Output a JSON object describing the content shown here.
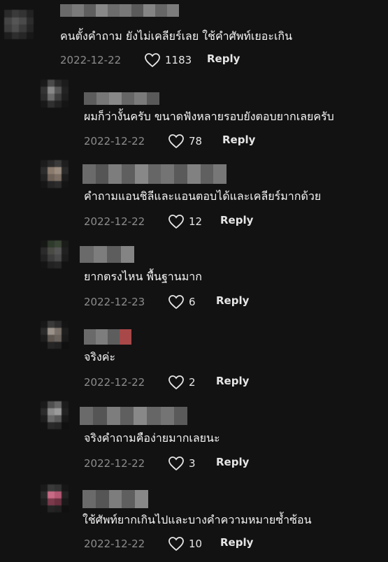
{
  "comments": [
    {
      "text": "คนตั้งคำถาม ยังไม่เคลียร์เลย ใช้คำศัพท์เยอะเกิน",
      "date": "2022-12-22",
      "likes": "1183",
      "reply_label": "Reply"
    },
    {
      "text": "ผมก็ว่างั้นครับ ขนาดฟังหลายรอบยังตอบยากเลยครับ",
      "date": "2022-12-22",
      "likes": "78",
      "reply_label": "Reply"
    },
    {
      "text": "คำถามแอนชิลีและแอนตอบได้และเคลียร์มากด้วย",
      "date": "2022-12-22",
      "likes": "12",
      "reply_label": "Reply"
    },
    {
      "text": "ยากตรงไหน พื้นฐานมาก",
      "date": "2022-12-23",
      "likes": "6",
      "reply_label": "Reply"
    },
    {
      "text": "จริงค่ะ",
      "date": "2022-12-22",
      "likes": "2",
      "reply_label": "Reply"
    },
    {
      "text": "จริงคำถามคือง่ายมากเลยนะ",
      "date": "2022-12-22",
      "likes": "3",
      "reply_label": "Reply"
    },
    {
      "text": "ใช้ศัพท์ยากเกินไปและบางคำความหมายซ้ำซ้อน",
      "date": "2022-12-22",
      "likes": "10",
      "reply_label": "Reply"
    }
  ],
  "colors": {
    "background": "#121212",
    "meta": "#8c8c8c",
    "text": "#f5f5f5"
  },
  "icons": {
    "like": "heart-outline-icon"
  }
}
